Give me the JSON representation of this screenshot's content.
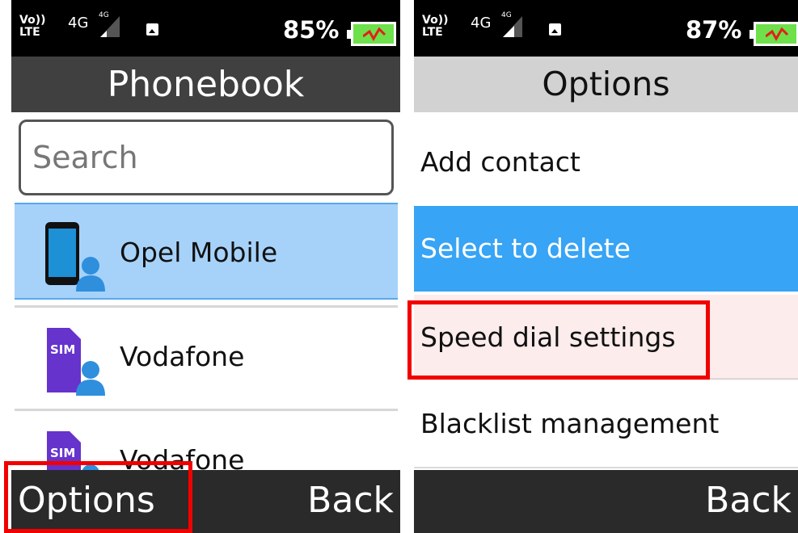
{
  "left_screen": {
    "status": {
      "network": "Vo))",
      "network_lte": "LTE",
      "data_type": "4G",
      "battery_percent": "85%"
    },
    "title": "Phonebook",
    "search": {
      "placeholder": "Search"
    },
    "contacts": [
      {
        "name": "Opel Mobile",
        "icon": "phone-contact-icon",
        "selected": true
      },
      {
        "name": "Vodafone",
        "icon": "sim-contact-icon",
        "selected": false
      },
      {
        "name": "Vodafone",
        "icon": "sim-contact-icon",
        "selected": false
      }
    ],
    "softkeys": {
      "left": "Options",
      "right": "Back"
    }
  },
  "right_screen": {
    "status": {
      "network": "Vo))",
      "network_lte": "LTE",
      "data_type": "4G",
      "battery_percent": "87%"
    },
    "title": "Options",
    "menu": [
      {
        "label": "Add contact",
        "selected": false
      },
      {
        "label": "Select to delete",
        "selected": true
      },
      {
        "label": "Speed dial settings",
        "selected": false,
        "highlighted": true
      },
      {
        "label": "Blacklist management",
        "selected": false
      }
    ],
    "softkeys": {
      "right": "Back"
    }
  },
  "colors": {
    "selection_light": "#a6d2fa",
    "selection_menu": "#37a4f5",
    "highlight_box": "#f20000",
    "battery": "#6ee04a"
  }
}
